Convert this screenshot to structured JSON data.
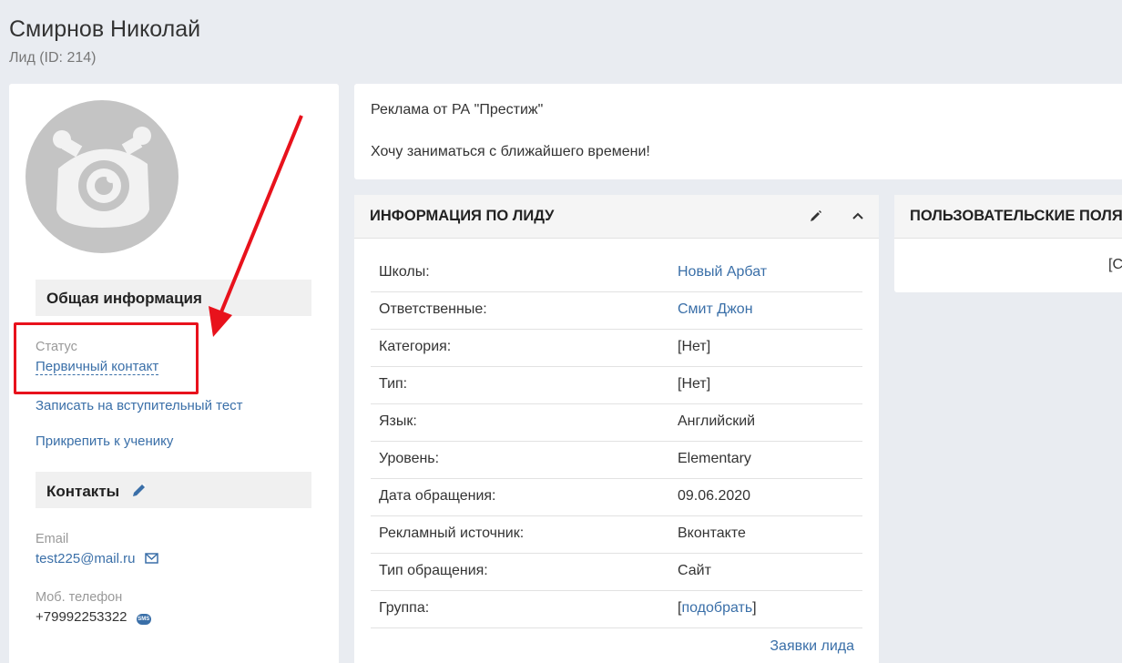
{
  "header": {
    "title": "Смирнов Николай",
    "subtitle": "Лид (ID: 214)"
  },
  "left": {
    "general_title": "Общая информация",
    "status_label": "Статус",
    "status_value": "Первичный контакт",
    "test_link": "Записать на вступительный тест",
    "attach_link": "Прикрепить к ученику",
    "contacts_title": "Контакты",
    "email_label": "Email",
    "email_value": "test225@mail.ru",
    "phone_label": "Моб. телефон",
    "phone_value": "+79992253322",
    "sms_icon_text": "SMS"
  },
  "comments": {
    "line1": "Реклама от РА \"Престиж\"",
    "line2": "Хочу заниматься с ближайшего времени!"
  },
  "info": {
    "title": "ИНФОРМАЦИЯ ПО ЛИДУ",
    "rows": [
      {
        "key": "Школы:",
        "value": "Новый Арбат"
      },
      {
        "key": "Ответственные:",
        "value": "Смит Джон"
      },
      {
        "key": "Категория:",
        "value": "[Нет]"
      },
      {
        "key": "Тип:",
        "value": "[Нет]"
      },
      {
        "key": "Язык:",
        "value": "Английский"
      },
      {
        "key": "Уровень:",
        "value": "Elementary"
      },
      {
        "key": "Дата обращения:",
        "value": "09.06.2020"
      },
      {
        "key": "Рекламный источник:",
        "value": "Вконтакте"
      },
      {
        "key": "Тип обращения:",
        "value": "Сайт"
      },
      {
        "key": "Группа:",
        "value_prefix": "[",
        "value": "подобрать",
        "value_suffix": "]"
      }
    ],
    "leads_link": "Заявки лида"
  },
  "custom": {
    "title": "ПОЛЬЗОВАТЕЛЬСКИЕ ПОЛЯ",
    "partial_text": "[С"
  },
  "colors": {
    "accent_link": "#3a6fa8",
    "highlight_red": "#e8121c",
    "background": "#e9ecf1"
  }
}
